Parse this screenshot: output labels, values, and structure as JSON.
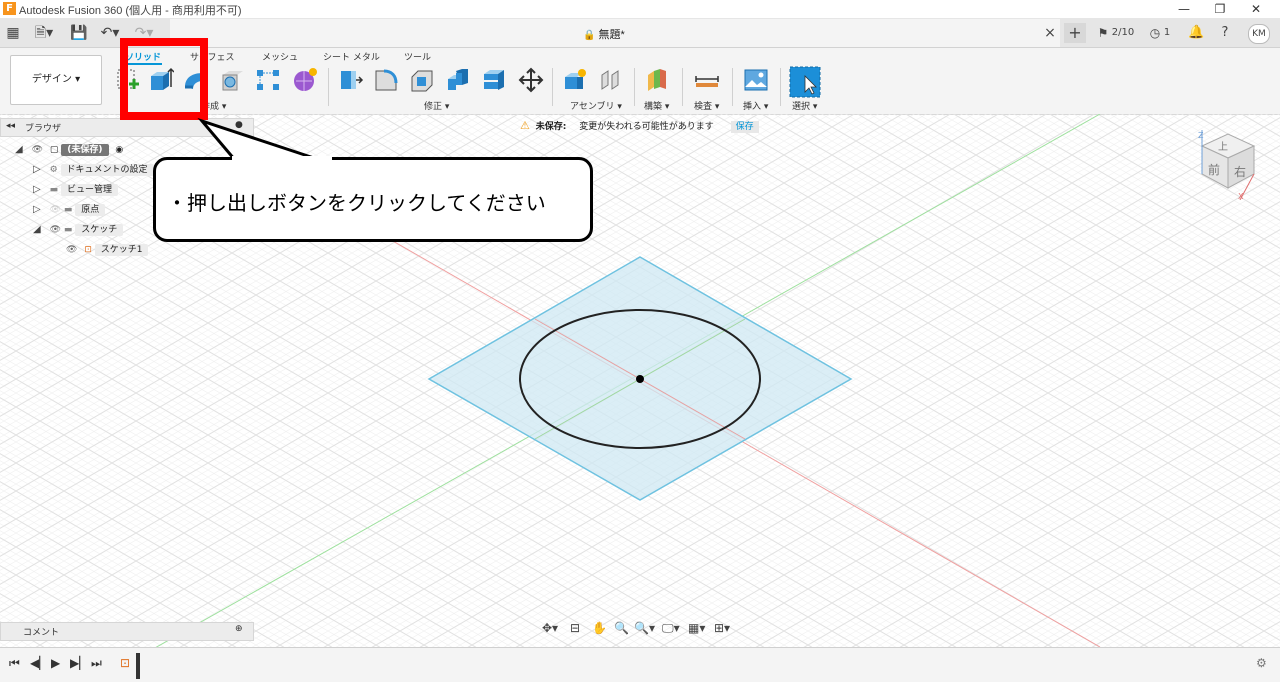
{
  "app": {
    "title": "Autodesk Fusion 360 (個人用 - 商用利用不可)",
    "icon_letter": "F",
    "minimize": "—",
    "restore": "❐",
    "close": "✕"
  },
  "qat": {
    "document_title": "無題*",
    "close_tab": "×",
    "new_tab": "+",
    "jobs": "2/10",
    "notifications": "1",
    "user_initials": "KM"
  },
  "toolbar": {
    "workspace": "デザイン ▾",
    "tabs": [
      "ソリッド",
      "サーフェス",
      "メッシュ",
      "シート メタル",
      "ツール"
    ],
    "groups": {
      "create": "作成 ▾",
      "modify": "修正 ▾",
      "assemble": "アセンブリ ▾",
      "construct": "構築 ▾",
      "inspect": "検査 ▾",
      "insert": "挿入 ▾",
      "select": "選択 ▾"
    }
  },
  "warning": {
    "label": "未保存:",
    "message": "変更が失われる可能性があります",
    "action": "保存"
  },
  "browser": {
    "title": "ブラウザ",
    "root": "(未保存)",
    "items": [
      {
        "label": "ドキュメントの設定"
      },
      {
        "label": "ビュー管理"
      },
      {
        "label": "原点"
      },
      {
        "label": "スケッチ"
      },
      {
        "label": "スケッチ1"
      }
    ]
  },
  "viewcube": {
    "top": "上",
    "front": "前",
    "right": "右",
    "axis_x": "X",
    "axis_z": "Z"
  },
  "callout": {
    "text": "・押し出しボタンをクリックしてください"
  },
  "comment_panel": {
    "title": "コメント"
  },
  "colors": {
    "accent": "#0696d7",
    "highlight": "#ff0000",
    "sketch_plane": "#cfe8f3",
    "sketch_plane_edge": "#6fc2e0"
  }
}
